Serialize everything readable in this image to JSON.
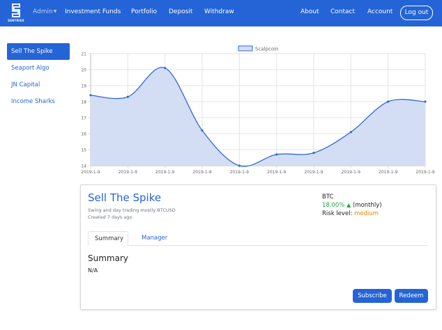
{
  "brand": {
    "logo_text": "SENTRIEX"
  },
  "nav": {
    "admin_label": "Admin",
    "left_links": [
      "Investment Funds",
      "Portfolio",
      "Deposit",
      "Withdraw"
    ],
    "right_links": [
      "About",
      "Contact",
      "Account"
    ],
    "logout_label": "Log out"
  },
  "sidebar": {
    "items": [
      {
        "label": "Sell The Spike",
        "active": true
      },
      {
        "label": "Seaport Algo",
        "active": false
      },
      {
        "label": "JN Capital",
        "active": false
      },
      {
        "label": "Income Sharks",
        "active": false
      }
    ]
  },
  "chart_data": {
    "type": "area",
    "legend": [
      "Scalpcoin"
    ],
    "legend_placement": "top-center",
    "x": [
      "2019-1-9",
      "2019-1-9",
      "2019-1-9",
      "2019-1-9",
      "2019-1-9",
      "2019-1-9",
      "2019-1-9",
      "2019-1-9",
      "2019-1-9",
      "2019-1-9"
    ],
    "series": [
      {
        "name": "Scalpcoin",
        "values": [
          18.4,
          18.3,
          20.1,
          16.2,
          14.0,
          14.7,
          14.8,
          16.1,
          18.0,
          18.0
        ]
      }
    ],
    "y_ticks": [
      "14",
      "15",
      "16",
      "17",
      "18",
      "19",
      "20",
      "21"
    ],
    "ylim": [
      14,
      21
    ],
    "grid": true,
    "fill_color": "#d3def5",
    "line_color": "#2f68d8"
  },
  "fund": {
    "title": "Sell The Spike",
    "description": "Swing and day trading mostly BTCUSD",
    "created": "Created 7 days ago",
    "asset": "BTC",
    "return_pct": "18.00%",
    "return_period": "(monthly)",
    "risk_label": "Risk level:",
    "risk_value": "medium",
    "tabs": [
      "Summary",
      "Manager"
    ],
    "summary_title": "Summary",
    "summary_body": "N/A",
    "subscribe_label": "Subscribe",
    "redeem_label": "Redeem"
  },
  "colors": {
    "primary": "#2464d6",
    "positive": "#28a745",
    "risk_medium": "#e08a00"
  }
}
